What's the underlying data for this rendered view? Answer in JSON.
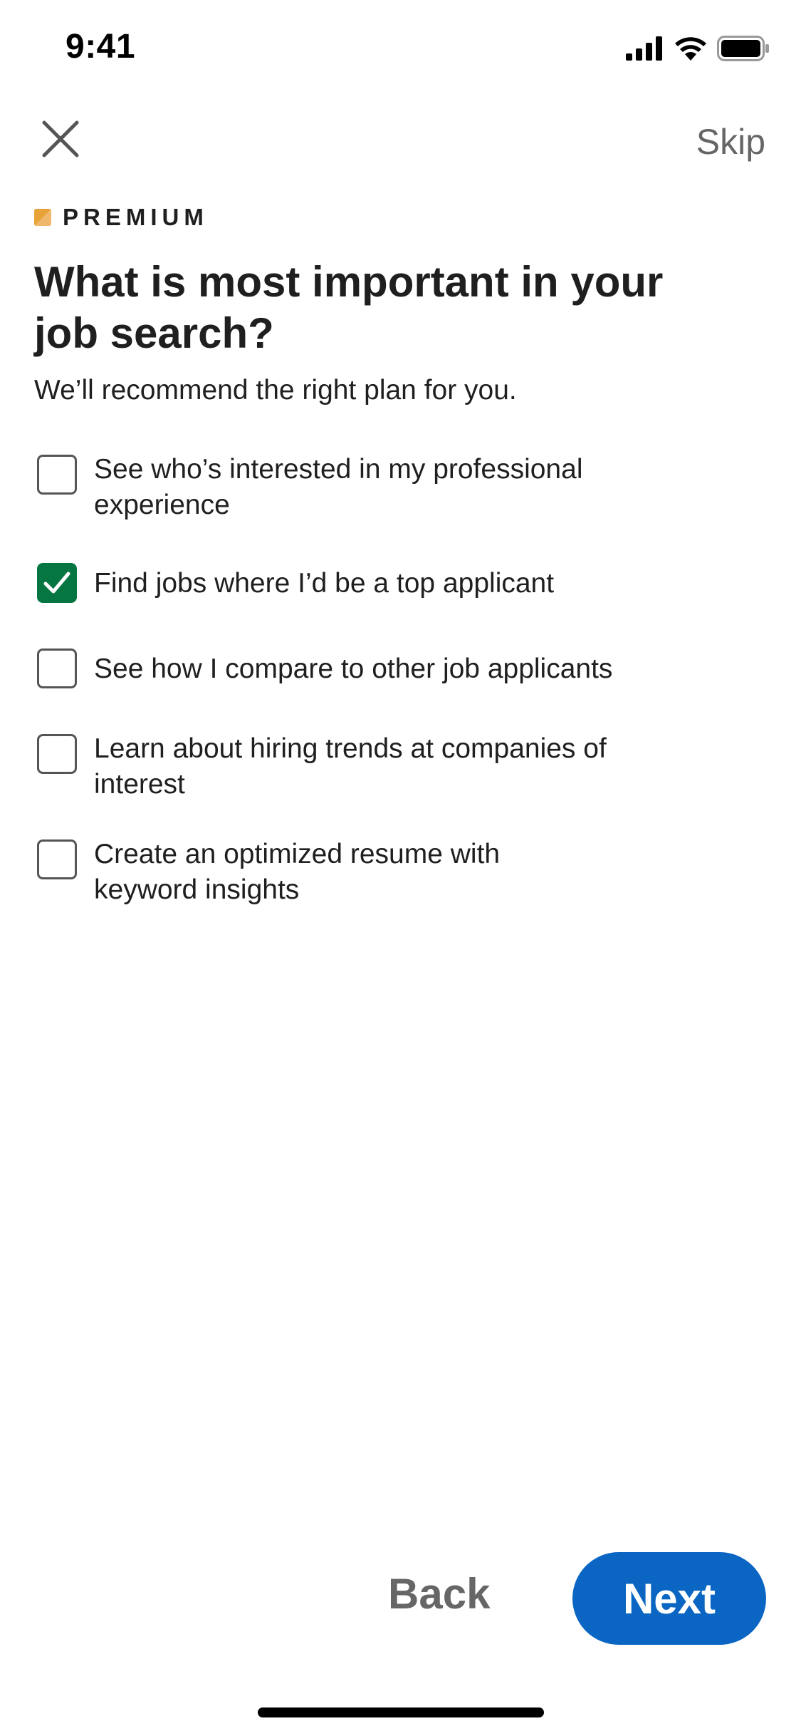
{
  "status_bar": {
    "time": "9:41",
    "icons": [
      "signal-icon",
      "wifi-icon",
      "battery-icon"
    ]
  },
  "nav": {
    "close_icon": "close-icon",
    "skip_label": "Skip"
  },
  "brand": {
    "label": "PREMIUM",
    "logo_colors": [
      "#f0b86b",
      "#e8a23a"
    ]
  },
  "content": {
    "title": "What is most important in your job search?",
    "subtitle": "We’ll recommend the right plan for you."
  },
  "options": [
    {
      "label": "See who’s interested in my professional experience",
      "checked": false
    },
    {
      "label": "Find jobs where I’d be a top applicant",
      "checked": true
    },
    {
      "label": "See how I compare to other job applicants",
      "checked": false
    },
    {
      "label": "Learn about hiring trends at companies of interest",
      "checked": false
    },
    {
      "label": "Create an optimized resume with keyword insights",
      "checked": false
    }
  ],
  "actions": {
    "back_label": "Back",
    "next_label": "Next"
  },
  "colors": {
    "primary": "#0a66c2",
    "checked": "#057642",
    "muted_text": "#666666"
  }
}
